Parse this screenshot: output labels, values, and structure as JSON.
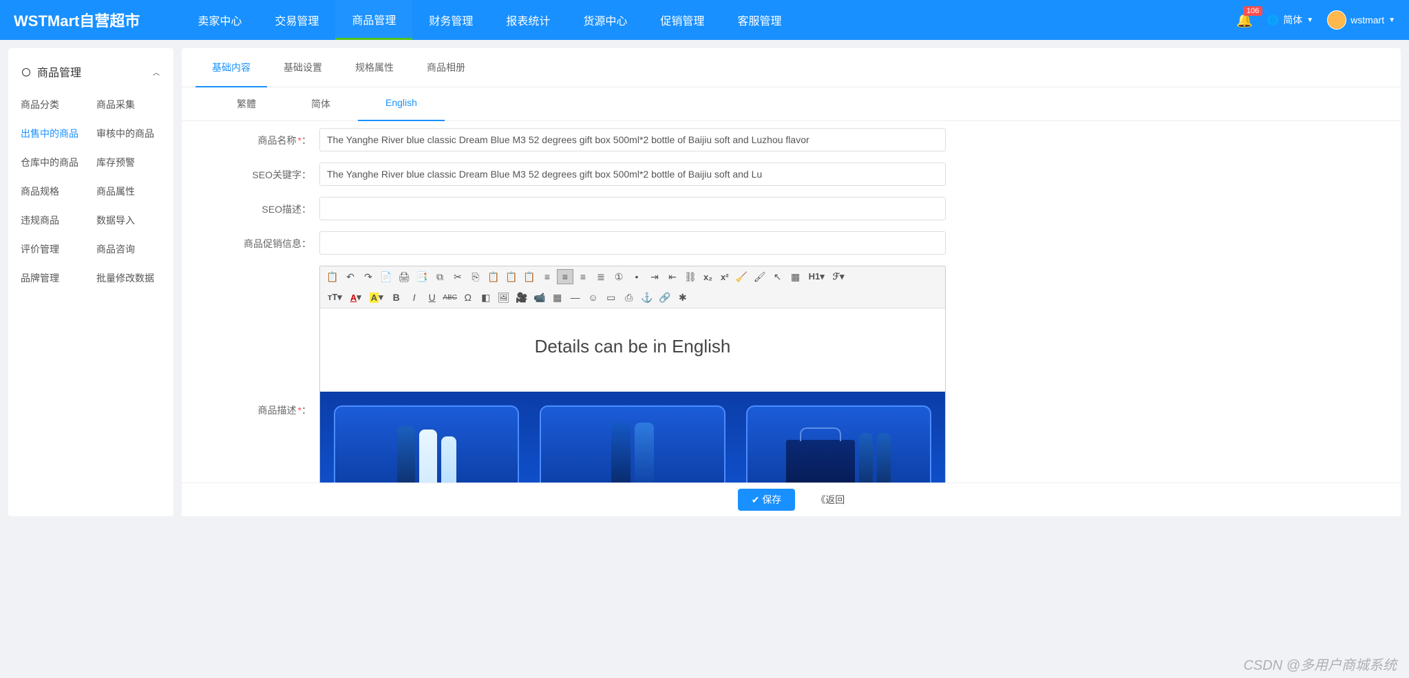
{
  "header": {
    "logo": "WSTMart自营超市",
    "nav": [
      "卖家中心",
      "交易管理",
      "商品管理",
      "财务管理",
      "报表统计",
      "货源中心",
      "促销管理",
      "客服管理"
    ],
    "nav_active_index": 2,
    "badge": "106",
    "lang_label": "简体",
    "username": "wstmart"
  },
  "sidebar": {
    "title": "商品管理",
    "items": [
      "商品分类",
      "商品采集",
      "出售中的商品",
      "审核中的商品",
      "仓库中的商品",
      "库存预警",
      "商品规格",
      "商品属性",
      "违规商品",
      "数据导入",
      "评价管理",
      "商品咨询",
      "品牌管理",
      "批量修改数据"
    ],
    "active_index": 2
  },
  "tabs": {
    "main": [
      "基础内容",
      "基础设置",
      "规格属性",
      "商品相册"
    ],
    "main_active_index": 0,
    "lang": [
      "繁體",
      "简体",
      "English"
    ],
    "lang_active_index": 2
  },
  "form": {
    "labels": {
      "name": "商品名称",
      "seo_kw": "SEO关键字：",
      "seo_desc": "SEO描述：",
      "promo": "商品促销信息：",
      "desc": "商品描述"
    },
    "values": {
      "name": "The Yanghe River blue classic Dream Blue M3 52 degrees gift box 500ml*2 bottle of Baijiu soft and Luzhou flavor",
      "seo_kw": "The Yanghe River blue classic Dream Blue M3 52 degrees gift box 500ml*2 bottle of Baijiu soft and Lu",
      "seo_desc": "",
      "promo": ""
    },
    "editor_heading": "Details can be in English"
  },
  "toolbar": {
    "r1": [
      "paste-icon",
      "undo-icon",
      "redo-icon",
      "paste-plain-icon",
      "print-icon",
      "preview-icon",
      "source-icon",
      "cut-icon",
      "copy-icon",
      "paste2-icon",
      "paste-word-icon",
      "clipboard-icon",
      "align-left-icon",
      "align-center-icon",
      "align-right-icon",
      "justify-icon",
      "ol-icon",
      "ul-icon",
      "indent-icon",
      "outdent-icon",
      "unlink-icon",
      "sub-icon",
      "sup-icon",
      "broom-icon",
      "format-icon",
      "cursor-icon",
      "select-all-icon",
      "heading-icon",
      "font-family-icon"
    ],
    "r2": [
      "font-size-icon",
      "font-color-icon",
      "highlight-icon",
      "bold-icon",
      "italic-icon",
      "underline-icon",
      "strike-icon",
      "charmap-icon",
      "eraser-icon",
      "image-icon",
      "media-icon",
      "flash-icon",
      "table-icon",
      "hr-icon",
      "emoji-icon",
      "frame-icon",
      "pagebreak-icon",
      "anchor-icon",
      "link-icon",
      "symbol-icon"
    ],
    "glyphs": {
      "paste-icon": "📋",
      "undo-icon": "↶",
      "redo-icon": "↷",
      "paste-plain-icon": "📄",
      "print-icon": "🖨",
      "preview-icon": "📑",
      "source-icon": "⧉",
      "cut-icon": "✂",
      "copy-icon": "⎘",
      "paste2-icon": "📋",
      "paste-word-icon": "📋",
      "clipboard-icon": "📋",
      "align-left-icon": "≡",
      "align-center-icon": "≡",
      "align-right-icon": "≡",
      "justify-icon": "≣",
      "ol-icon": "①",
      "ul-icon": "•",
      "indent-icon": "⇥",
      "outdent-icon": "⇤",
      "unlink-icon": "⛓",
      "sub-icon": "x₂",
      "sup-icon": "x²",
      "broom-icon": "🧹",
      "format-icon": "🖌",
      "cursor-icon": "↖",
      "select-all-icon": "▦",
      "heading-icon": "H1▾",
      "font-family-icon": "ℱ▾",
      "font-size-icon": "тT▾",
      "font-color-icon": "A▾",
      "highlight-icon": "A▾",
      "bold-icon": "B",
      "italic-icon": "I",
      "underline-icon": "U",
      "strike-icon": "ABC",
      "charmap-icon": "Ω",
      "eraser-icon": "◧",
      "image-icon": "🖼",
      "media-icon": "🎥",
      "flash-icon": "📹",
      "table-icon": "▦",
      "hr-icon": "—",
      "emoji-icon": "☺",
      "frame-icon": "▭",
      "pagebreak-icon": "⎙",
      "anchor-icon": "⚓",
      "link-icon": "🔗",
      "symbol-icon": "✱"
    }
  },
  "footer": {
    "save": "保存",
    "back": "《返回"
  },
  "watermark": "CSDN @多用户商城系统"
}
